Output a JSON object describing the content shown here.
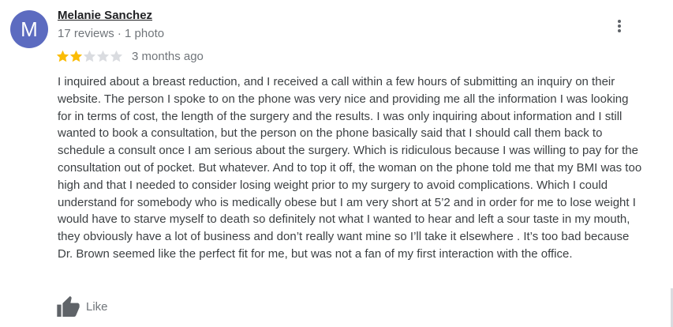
{
  "reviewer": {
    "initial": "M",
    "name": "Melanie Sanchez",
    "meta": "17 reviews · 1 photo",
    "avatar_color": "#5c6bc0"
  },
  "rating": {
    "value": 2,
    "max": 5,
    "filled_color": "#fbbc04",
    "empty_color": "#dadce0"
  },
  "date": "3 months ago",
  "review_text": "I inquired about a breast reduction, and I received a call within a few hours of submitting an inquiry on their website. The person I spoke to on the phone was very nice and providing me all the information I was looking for in terms of cost, the length of the surgery and the results. I was only inquiring about information and I still wanted to book a consultation, but the person on the phone basically said that I should call them back to schedule a consult once I am serious about the surgery. Which is ridiculous because I was willing to pay for the consultation out of pocket. But whatever. And to top it off, the woman on the phone told me that my BMI was too high and that I needed to consider losing weight prior to my surgery to avoid complications. Which I could understand for somebody who is medically obese but I am very short at 5’2 and in order for me to lose weight I would have to starve myself to death so definitely not what I wanted to hear and left a sour taste in my mouth, they obviously have a lot of business and don’t really want mine so I’ll take it elsewhere . It’s too bad because Dr. Brown seemed like the perfect fit for me, but was not a fan of my first interaction with the office.",
  "actions": {
    "like_label": "Like",
    "more_icon": "more-vert-icon",
    "like_icon": "thumbs-up-icon"
  }
}
